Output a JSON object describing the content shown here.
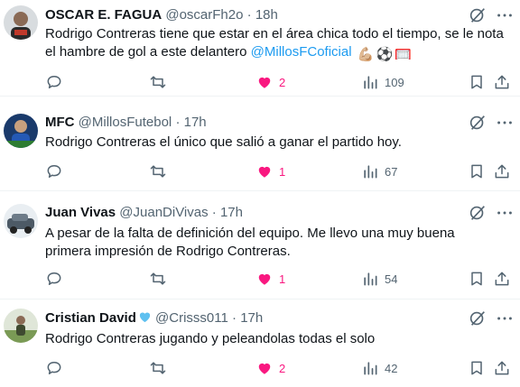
{
  "tweets": [
    {
      "name": "OSCAR E. FAGUA",
      "handle": "@oscarFh2o",
      "separator": "·",
      "time": "18h",
      "verified": false,
      "text_before": "Rodrigo Contreras tiene que estar en el área chica todo el tiempo, se le nota el hambre de gol a este delantero ",
      "mention": "@MillosFCoficial",
      "emojis": [
        "💪🏼",
        "⚽",
        "🥅"
      ],
      "likes": "2",
      "views": "109"
    },
    {
      "name": "MFC",
      "handle": "@MillosFutebol",
      "separator": "·",
      "time": "17h",
      "verified": false,
      "text_before": "Rodrigo Contreras el único que salió a ganar el partido hoy.",
      "mention": "",
      "emojis": [],
      "likes": "1",
      "views": "67"
    },
    {
      "name": "Juan Vivas",
      "handle": "@JuanDiVivas",
      "separator": "·",
      "time": "17h",
      "verified": false,
      "text_before": "A pesar de la falta de definición del equipo. Me llevo una muy buena primera impresión de Rodrigo Contreras.",
      "mention": "",
      "emojis": [],
      "likes": "1",
      "views": "54"
    },
    {
      "name": "Cristian David",
      "handle": "@Crisss011",
      "separator": "·",
      "time": "17h",
      "verified": true,
      "text_before": "Rodrigo Contreras jugando y peleandolas todas el solo",
      "mention": "",
      "emojis": [],
      "likes": "2",
      "views": "42"
    }
  ],
  "colors": {
    "text": "#0f1419",
    "muted": "#536471",
    "link": "#1d9bf0",
    "like": "#f91880",
    "divider": "#eff3f4",
    "verified_heart": "#5ec0f0"
  },
  "icons": {
    "reply": "reply-icon",
    "retweet": "retweet-icon",
    "like": "heart-filled-icon",
    "views": "views-icon",
    "bookmark": "bookmark-icon",
    "share": "share-icon",
    "grok": "grok-icon",
    "more": "more-icon"
  }
}
